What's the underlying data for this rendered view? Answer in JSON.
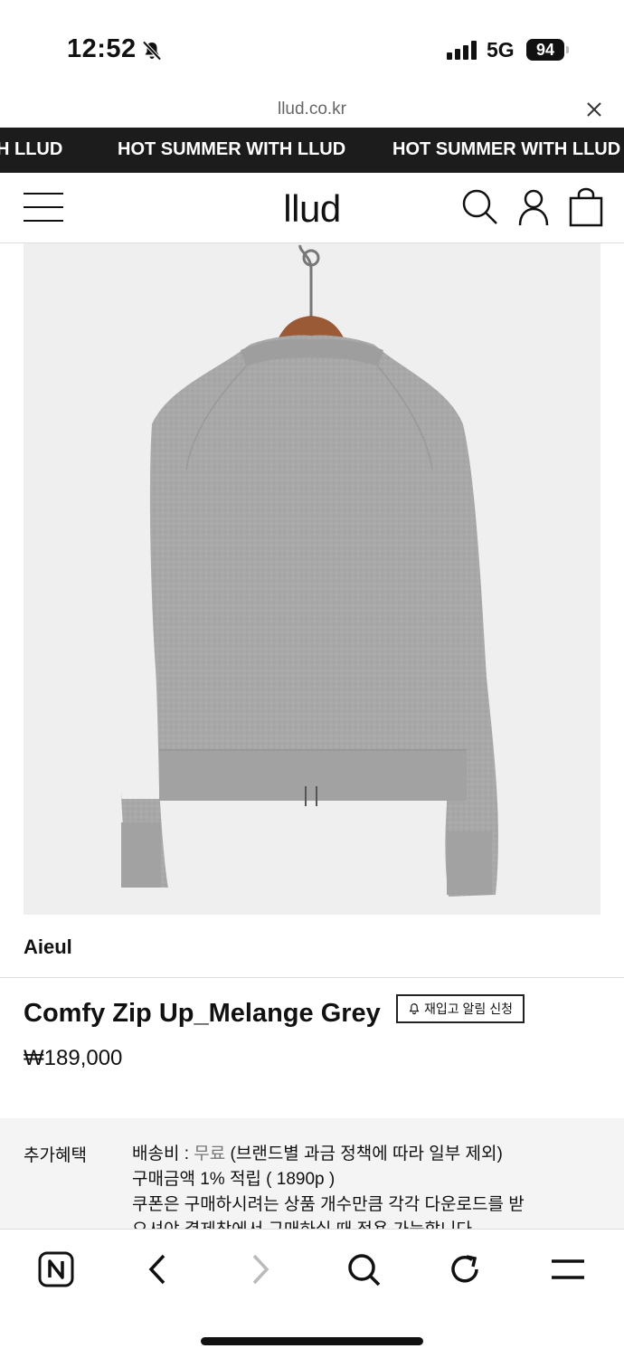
{
  "status_bar": {
    "time": "12:52",
    "network": "5G",
    "battery": "94",
    "signal_bars": 4
  },
  "browser": {
    "url": "llud.co.kr"
  },
  "marquee": {
    "items": [
      "H LLUD",
      "HOT SUMMER WITH LLUD",
      "HOT SUMMER WITH LLUD"
    ]
  },
  "header": {
    "logo": "llud"
  },
  "product": {
    "brand": "Aieul",
    "title": "Comfy Zip Up_Melange Grey",
    "restock_label": "재입고 알림 신청",
    "price": "₩189,000",
    "image_alt": "grey melange zip-up knit on hanger (back view)"
  },
  "benefits": {
    "label": "추가혜택",
    "shipping_prefix": "배송비 : ",
    "shipping_value": "무료",
    "shipping_suffix": " (브랜드별 과금 정책에 따라 일부 제외)",
    "points": "구매금액 1% 적립 ( 1890p )",
    "coupon": "쿠폰은 구매하시려는 상품 개수만큼 각각 다운로드를 받",
    "coupon_cont": "으셔야 결제창에서 구매하실 때 적용 가능합니다."
  },
  "icons": {
    "status": [
      "bell-off-icon",
      "signal-icon",
      "battery-icon"
    ],
    "url_bar": [
      "close-icon"
    ],
    "header": [
      "menu-icon",
      "search-icon",
      "user-icon",
      "bag-icon"
    ],
    "bottom_nav": [
      "naver-home-icon",
      "back-icon",
      "forward-icon",
      "search-icon",
      "refresh-icon",
      "menu-icon"
    ]
  },
  "colors": {
    "marquee_bg": "#1c1c1c",
    "benefit_bg": "#f4f4f4",
    "image_bg": "#efefef",
    "garment": "#a9a9a9"
  }
}
